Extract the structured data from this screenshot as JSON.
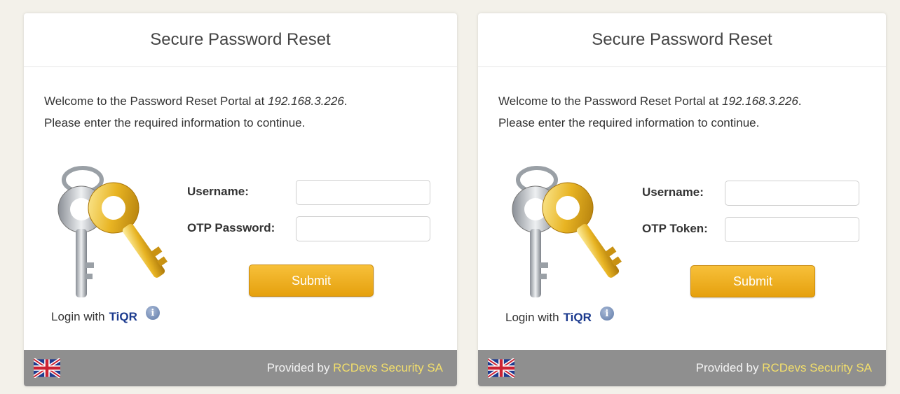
{
  "panels": [
    {
      "title": "Secure Password Reset",
      "welcome_prefix": "Welcome to the Password Reset Portal at ",
      "welcome_ip": "192.168.3.226",
      "welcome_suffix": ".",
      "instructions": "Please enter the required information to continue.",
      "username_label": "Username:",
      "second_label": "OTP Password:",
      "submit_label": "Submit",
      "login_with": "Login with",
      "tiqr_label": "TiQR",
      "info_glyph": "i",
      "provided_by": "Provided by ",
      "provider_name": "RCDevs Security SA",
      "language_flag": "uk-flag-icon"
    },
    {
      "title": "Secure Password Reset",
      "welcome_prefix": "Welcome to the Password Reset Portal at ",
      "welcome_ip": "192.168.3.226",
      "welcome_suffix": ".",
      "instructions": "Please enter the required information to continue.",
      "username_label": "Username:",
      "second_label": "OTP Token:",
      "submit_label": "Submit",
      "login_with": "Login with",
      "tiqr_label": "TiQR",
      "info_glyph": "i",
      "provided_by": "Provided by ",
      "provider_name": "RCDevs Security SA",
      "language_flag": "uk-flag-icon"
    }
  ],
  "colors": {
    "background": "#f3f1ea",
    "footer": "#8f8f8f",
    "button": "#eaa912",
    "tiqr": "#1b3a8e",
    "provider_link": "#f3df6b"
  }
}
